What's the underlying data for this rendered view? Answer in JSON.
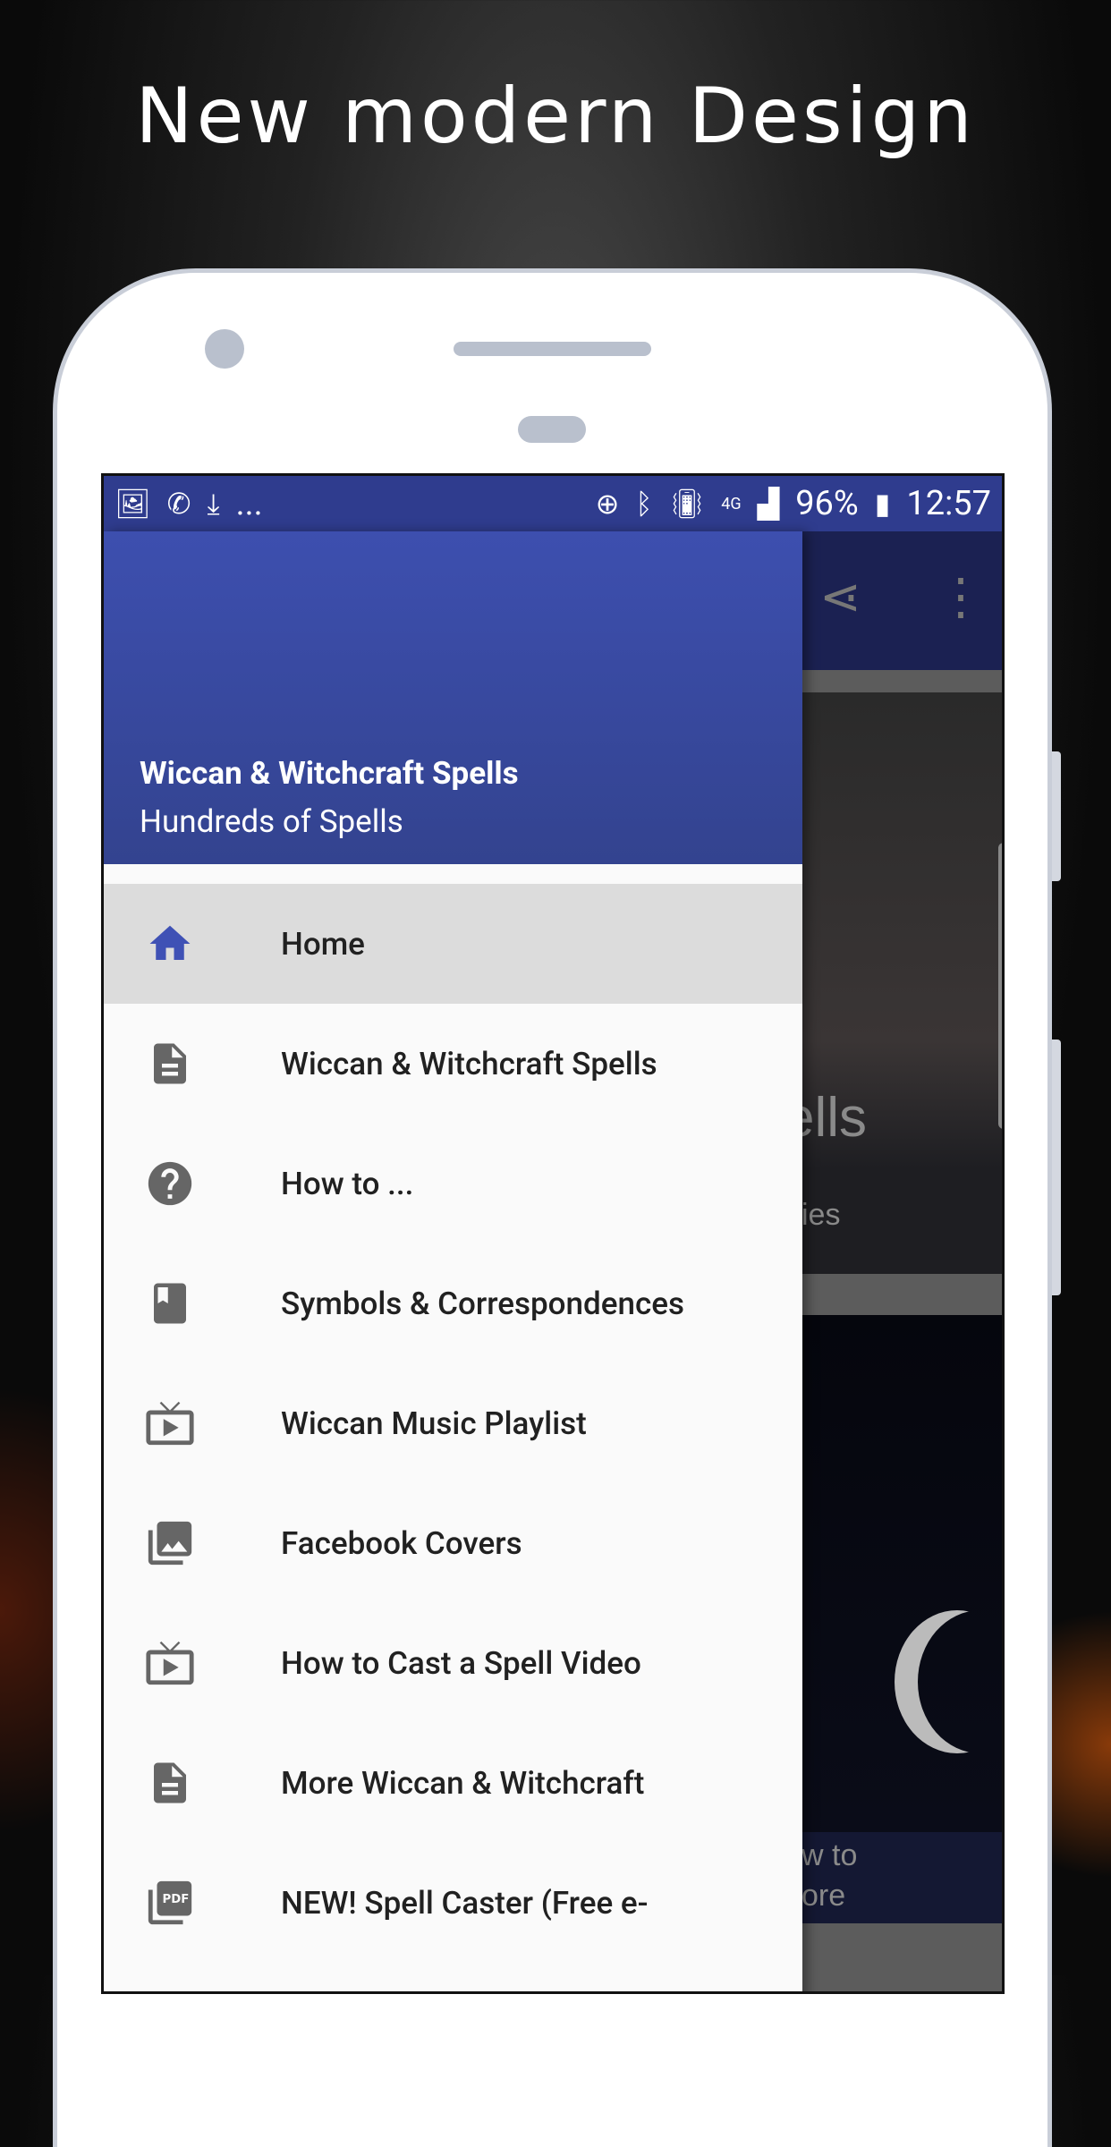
{
  "headline": "New modern Design",
  "status_bar": {
    "left_icons": [
      "image-icon",
      "whatsapp-icon",
      "download-icon"
    ],
    "overflow": "...",
    "right_icons": [
      "data-saver-icon",
      "bluetooth-icon",
      "vibrate-icon",
      "4g-icon",
      "signal-icon"
    ],
    "battery": "96%",
    "time": "12:57"
  },
  "app_bar": {
    "icons": [
      "share-icon",
      "more-vert-icon"
    ]
  },
  "drawer": {
    "title": "Wiccan & Witchcraft Spells",
    "subtitle": "Hundreds of Spells",
    "accent": "#3f51b5",
    "items": [
      {
        "label": "Home",
        "icon": "home-icon",
        "active": true
      },
      {
        "label": "Wiccan & Witchcraft Spells",
        "icon": "document-icon"
      },
      {
        "label": "How to ...",
        "icon": "help-icon"
      },
      {
        "label": "Symbols & Correspondences",
        "icon": "book-icon"
      },
      {
        "label": "Wiccan Music Playlist",
        "icon": "tv-play-icon"
      },
      {
        "label": "Facebook Covers",
        "icon": "photo-library-icon"
      },
      {
        "label": "How to Cast a Spell Video",
        "icon": "tv-play-icon"
      },
      {
        "label": "More Wiccan & Witchcraft",
        "icon": "document-icon"
      },
      {
        "label": "NEW! Spell Caster (Free e-",
        "icon": "pdf-icon"
      }
    ]
  },
  "background_cards": [
    {
      "title_fragment": "ells",
      "subtitle_fragment": "ies"
    },
    {
      "text_line1": "w to",
      "text_line2": "ore"
    }
  ]
}
